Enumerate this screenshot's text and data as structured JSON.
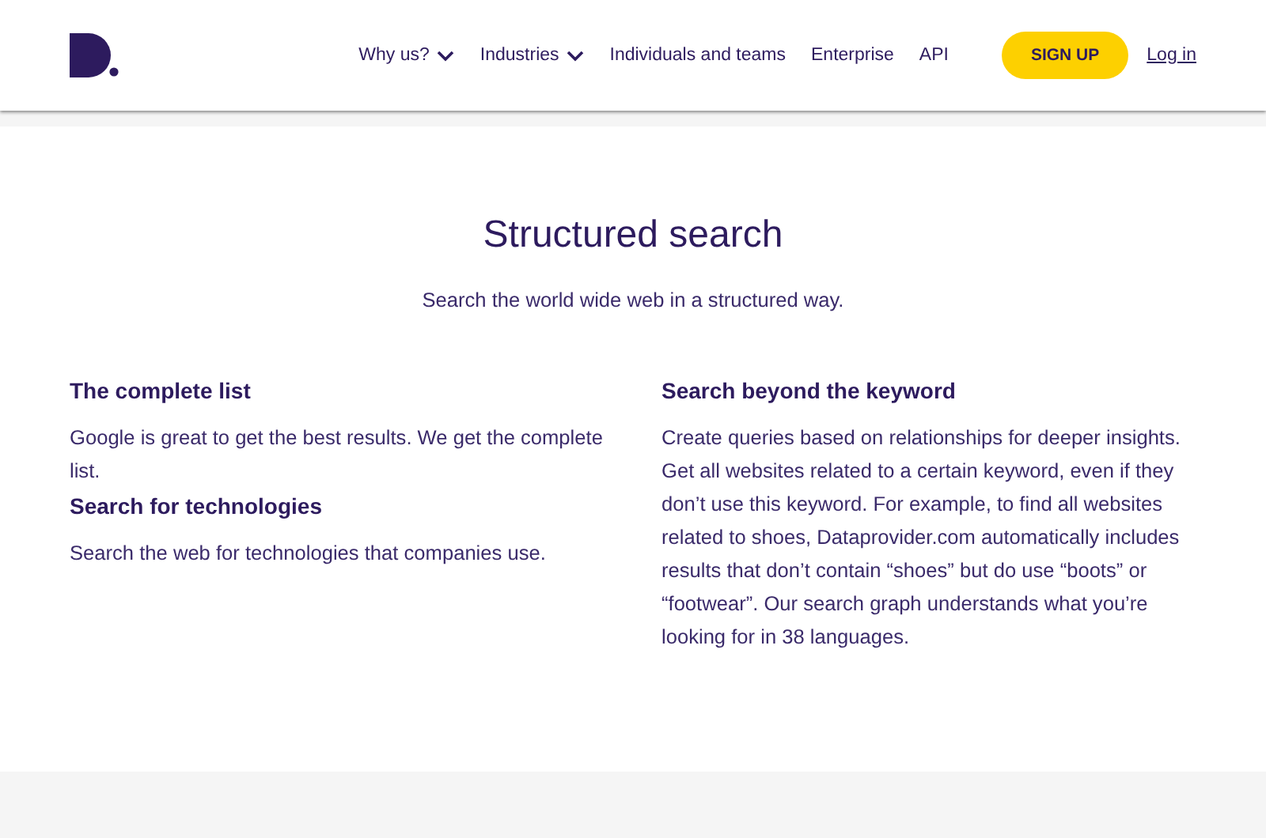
{
  "header": {
    "nav": [
      {
        "label": "Why us?",
        "kind": "dropdown"
      },
      {
        "label": "Industries",
        "kind": "dropdown"
      },
      {
        "label": "Individuals and teams",
        "kind": "link"
      },
      {
        "label": "Enterprise",
        "kind": "link"
      },
      {
        "label": "API",
        "kind": "link"
      }
    ],
    "signup": "SIGN UP",
    "login": "Log in"
  },
  "title": "Structured search",
  "subtitle": "Search the world wide web in a structured way.",
  "columns": [
    [
      {
        "heading": "The complete list",
        "text": "Google is great to get the best results. We get the complete list."
      },
      {
        "heading": "Search for technologies",
        "text": "Search the web for technologies that companies use."
      }
    ],
    [
      {
        "heading": "Search beyond the keyword",
        "text": "Create queries based on relationships for deeper insights. Get all websites related to a certain keyword, even if they don’t use this keyword. For example, to find all websites related to shoes, Dataprovider.com automatically includes results that don’t contain “shoes” but do use “boots” or “footwear”. Our search graph understands what you’re looking for in 38 languages."
      }
    ]
  ]
}
